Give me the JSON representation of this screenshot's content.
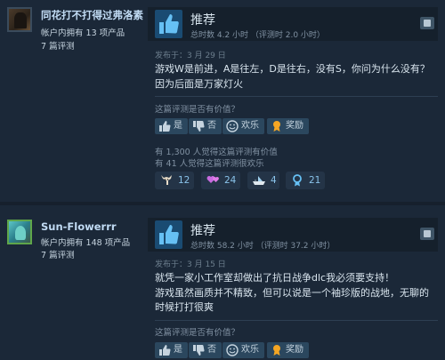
{
  "reviews": [
    {
      "username": "同花打不打得过弗洛素",
      "products": "帐户内拥有 13 项产品",
      "review_count": "7 篇评测",
      "recommendation": "推荐",
      "hours": "总时数 4.2 小时 （评测时 2.0 小时）",
      "posted": "发布于：3 月 29 日",
      "body": [
        "游戏W是前进，A是往左，D是往右，没有S，你问为什么没有？因为后面是万家灯火"
      ],
      "helpful_prompt": "这篇评测是否有价值？",
      "buttons": {
        "yes": "是",
        "no": "否",
        "funny": "欢乐",
        "award": "奖励"
      },
      "stats": [
        "有 1,300 人觉得这篇评测有价值",
        "有 41 人觉得这篇评测很欢乐"
      ],
      "awards": [
        {
          "icon": "deer-icon",
          "count": "12"
        },
        {
          "icon": "heart-eyes-icon",
          "count": "24"
        },
        {
          "icon": "boat-icon",
          "count": "4"
        },
        {
          "icon": "medal-icon",
          "count": "21"
        }
      ]
    },
    {
      "username": "Sun-Flowerrr",
      "products": "帐户内拥有 148 项产品",
      "review_count": "7 篇评测",
      "recommendation": "推荐",
      "hours": "总时数 58.2 小时 （评测时 37.2 小时）",
      "posted": "发布于：3 月 15 日",
      "body": [
        "就凭一家小工作室却做出了抗日战争dlc我必须要支持！",
        "游戏虽然画质并不精致，但可以说是一个袖珍版的战地，无聊的时候打打很爽"
      ],
      "helpful_prompt": "这篇评测是否有价值？",
      "buttons": {
        "yes": "是",
        "no": "否",
        "funny": "欢乐",
        "award": "奖励"
      }
    }
  ],
  "colors": {
    "background": "#1b2838",
    "button": "#2b475e",
    "thumb": "#1a4b72",
    "link": "#8ac3ea"
  }
}
